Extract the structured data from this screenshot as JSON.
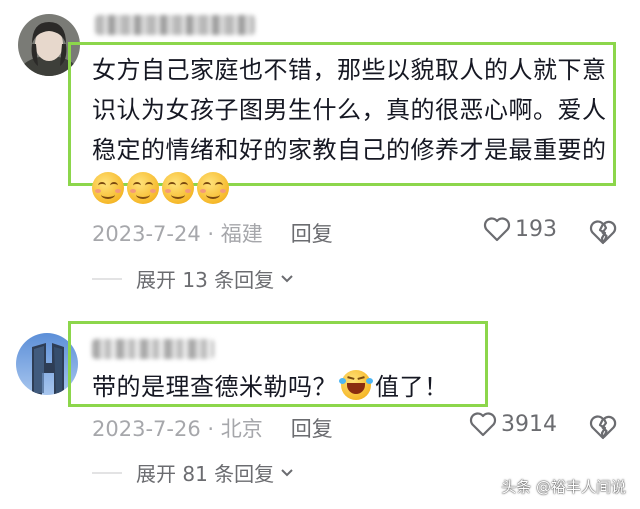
{
  "comments": [
    {
      "text": "女方自己家庭也不错，那些以貌取人的人就下意识认为女孩子图男生什么，真的很恶心啊。爱人稳定的情绪和好的家教自己的修养才是最重要的",
      "emojis": [
        "smiling-face-emoji",
        "smiling-face-emoji",
        "smiling-face-emoji",
        "smiling-face-emoji"
      ],
      "date_location": "2023-7-24 · 福建",
      "reply_label": "回复",
      "likes": "193",
      "expand_label": "展开 13 条回复"
    },
    {
      "text_before": "带的是理查德米勒吗？",
      "emoji": "laughing-crying-emoji",
      "text_after": "值了！",
      "date_location": "2023-7-26 · 北京",
      "reply_label": "回复",
      "likes": "3914",
      "expand_label": "展开 81 条回复"
    }
  ],
  "watermark": "头条 @裕丰人间说",
  "colors": {
    "highlight_border": "#8cd64b",
    "meta_text": "#a6a7ab",
    "action_text": "#6b6c70"
  }
}
